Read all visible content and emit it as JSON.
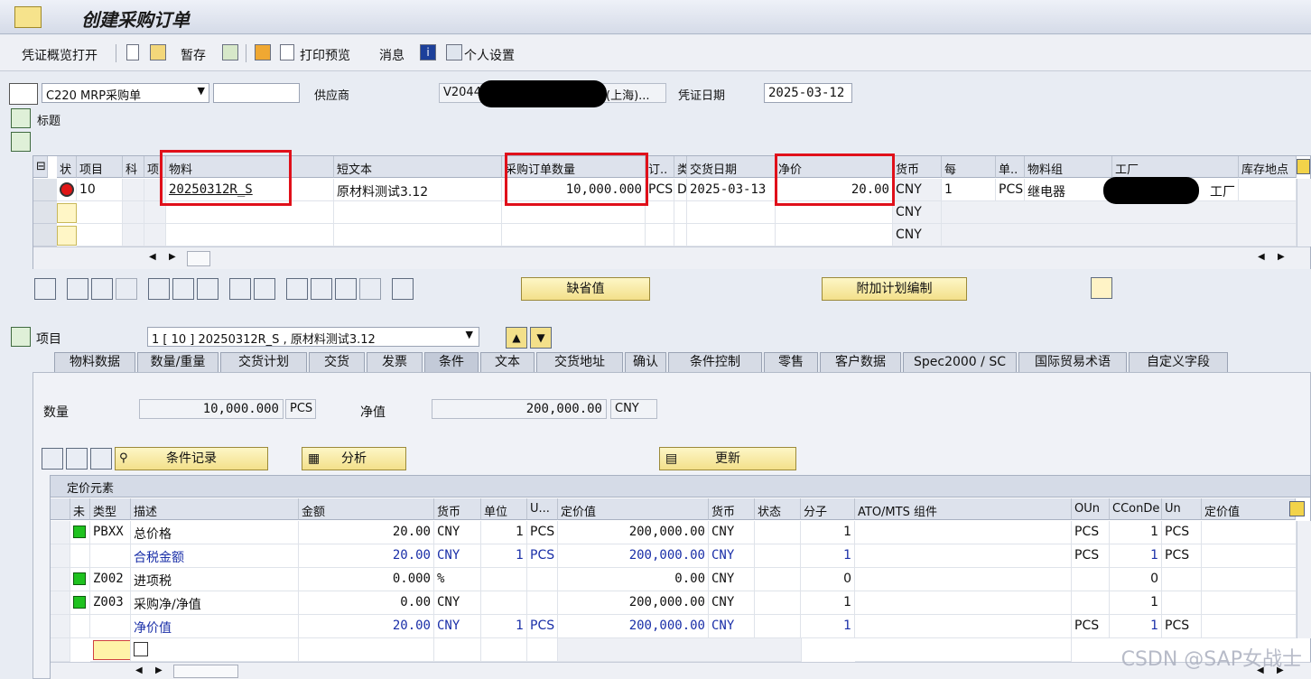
{
  "window": {
    "title": "创建采购订单"
  },
  "toolbar": {
    "overview": "凭证概览打开",
    "hold": "暂存",
    "print_preview": "打印预览",
    "messages": "消息",
    "personal_settings": "个人设置"
  },
  "header": {
    "doc_type": "C220 MRP采购单",
    "doc_number": "",
    "vendor_label": "供应商",
    "vendor_value_left": "V2044",
    "vendor_value_right": "(上海)...",
    "doc_date_label": "凭证日期",
    "doc_date": "2025-03-12",
    "title_section": "标题"
  },
  "items": {
    "columns": [
      "状",
      "项目",
      "科",
      "项",
      "物料",
      "短文本",
      "采购订单数量",
      "订..",
      "类",
      "交货日期",
      "净价",
      "货币",
      "每",
      "单..",
      "物料组",
      "工厂",
      "库存地点"
    ],
    "rows": [
      {
        "item": "10",
        "material": "20250312R_S",
        "short_text": "原材料测试3.12",
        "qty": "10,000.000",
        "uom": "PCS",
        "cat": "D",
        "delivery": "2025-03-13",
        "net_price": "20.00",
        "currency": "CNY",
        "per": "1",
        "unit": "PCS",
        "mat_group": "继电器",
        "plant": "工厂"
      },
      {
        "currency": "CNY"
      },
      {
        "currency": "CNY"
      }
    ]
  },
  "buttons": {
    "defaults": "缺省值",
    "extra_planning": "附加计划编制",
    "cond_record": "条件记录",
    "analysis": "分析",
    "update": "更新"
  },
  "item_detail": {
    "label": "项目",
    "selected": "1 [ 10 ] 20250312R_S , 原材料测试3.12"
  },
  "tabs": [
    "物料数据",
    "数量/重量",
    "交货计划",
    "交货",
    "发票",
    "条件",
    "文本",
    "交货地址",
    "确认",
    "条件控制",
    "零售",
    "客户数据",
    "Spec2000 / SC",
    "国际贸易术语",
    "自定义字段"
  ],
  "active_tab": "条件",
  "conditions": {
    "qty_label": "数量",
    "qty_value": "10,000.000",
    "qty_unit": "PCS",
    "net_label": "净值",
    "net_value": "200,000.00",
    "net_currency": "CNY"
  },
  "pricing": {
    "caption": "定价元素",
    "columns": [
      "未",
      "类型",
      "描述",
      "金额",
      "货币",
      "单位",
      "U...",
      "定价值",
      "货币",
      "状态",
      "分子",
      "ATO/MTS 组件",
      "OUn",
      "CConDe",
      "Un",
      "定价值"
    ],
    "rows": [
      {
        "status": "green",
        "type": "PBXX",
        "desc": "总价格",
        "amount": "20.00",
        "curr": "CNY",
        "unit": "1",
        "u": "PCS",
        "cond_value": "200,000.00",
        "curr2": "CNY",
        "numer": "1",
        "oun": "PCS",
        "ccon": "1",
        "un": "PCS",
        "blue": false
      },
      {
        "status": "",
        "type": "",
        "desc": "合税金额",
        "amount": "20.00",
        "curr": "CNY",
        "unit": "1",
        "u": "PCS",
        "cond_value": "200,000.00",
        "curr2": "CNY",
        "numer": "1",
        "oun": "PCS",
        "ccon": "1",
        "un": "PCS",
        "blue": true
      },
      {
        "status": "green",
        "type": "Z002",
        "desc": "进项税",
        "amount": "0.000",
        "curr": "%",
        "unit": "",
        "u": "",
        "cond_value": "0.00",
        "curr2": "CNY",
        "numer": "0",
        "oun": "",
        "ccon": "0",
        "un": "",
        "blue": false
      },
      {
        "status": "green",
        "type": "Z003",
        "desc": "采购净/净值",
        "amount": "0.00",
        "curr": "CNY",
        "unit": "",
        "u": "",
        "cond_value": "200,000.00",
        "curr2": "CNY",
        "numer": "1",
        "oun": "",
        "ccon": "1",
        "un": "",
        "blue": false
      },
      {
        "status": "",
        "type": "",
        "desc": "净价值",
        "amount": "20.00",
        "curr": "CNY",
        "unit": "1",
        "u": "PCS",
        "cond_value": "200,000.00",
        "curr2": "CNY",
        "numer": "1",
        "oun": "PCS",
        "ccon": "1",
        "un": "PCS",
        "blue": true
      }
    ]
  },
  "watermark": "CSDN @SAP女战士"
}
